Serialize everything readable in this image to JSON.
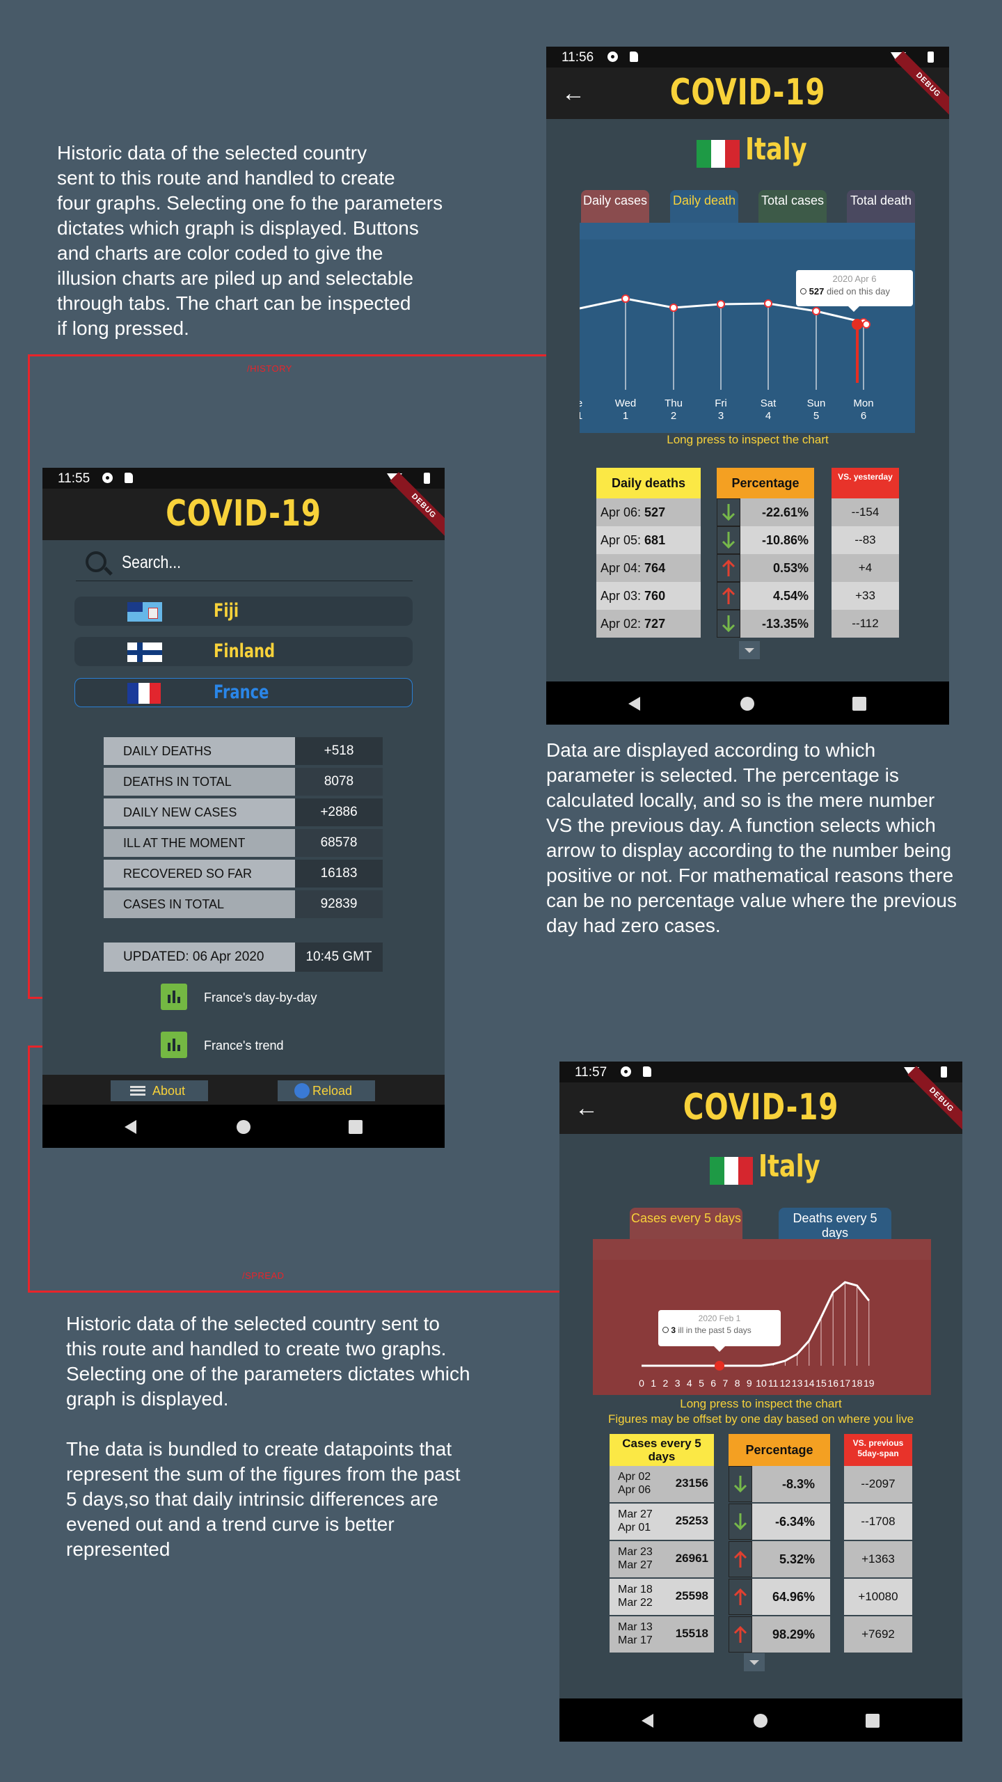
{
  "descriptions": {
    "history_top": [
      "Historic data of the selected country",
      "sent to this route and handled to create",
      "four graphs. Selecting one fo the parameters",
      "dictates which graph is displayed. Buttons",
      "and charts are color coded to give the",
      "illusion charts are piled up and selectable",
      "through tabs. The chart can be inspected",
      "if long pressed."
    ],
    "data_middle": [
      "Data are displayed according to which",
      "parameter is selected. The percentage is",
      "calculated locally, and so is the mere number",
      "VS the previous day. A function selects which",
      "arrow to display according to the number being",
      "positive or not. For mathematical reasons there",
      "can be no percentage value where the previous",
      "day had zero cases."
    ],
    "spread_bottom": [
      "Historic data of the selected country sent to",
      "this route and handled to create two graphs.",
      "Selecting one of the parameters dictates which",
      "graph is displayed.",
      "",
      "The data is bundled to create datapoints that",
      "represent the sum of the figures from the past",
      "5 days,so that daily intrinsic differences are",
      "evened out and a trend curve is better",
      "represented"
    ]
  },
  "routes": {
    "history": "/HISTORY",
    "spread": "/SPREAD"
  },
  "colors": {
    "background": "#485a68",
    "title_yellow": "#f8d23a",
    "route_red": "#e8242a",
    "chart_blue": "#2b5a80",
    "chart_red": "#8a3a3a",
    "arrow_green": "#76b84a",
    "arrow_red": "#e04030"
  },
  "app_title": "COVID-19",
  "debug_label": "DEBUG",
  "history": {
    "time": "11:56",
    "country": "Italy",
    "tabs": [
      {
        "label": "Daily cases",
        "color": "#8a4c4e"
      },
      {
        "label": "Daily death",
        "color": "#2d5b82"
      },
      {
        "label": "Total cases",
        "color": "#3d5a48"
      },
      {
        "label": "Total death",
        "color": "#4a4960"
      }
    ],
    "tooltip": {
      "date": "2020 Apr 6",
      "value": "527",
      "text": "died on this day"
    },
    "x_ticks": [
      [
        "e",
        "1"
      ],
      [
        "Wed",
        "1"
      ],
      [
        "Thu",
        "2"
      ],
      [
        "Fri",
        "3"
      ],
      [
        "Sat",
        "4"
      ],
      [
        "Sun",
        "5"
      ],
      [
        "Mon",
        "6"
      ]
    ],
    "hint": "Long press to inspect the chart",
    "table_headers": {
      "col1": "Daily deaths",
      "col2": "Percentage",
      "col3": "VS. yesterday"
    },
    "rows": [
      {
        "date": "Apr 06:",
        "value": "527",
        "trend": "down",
        "pct": "-22.61%",
        "vs": "--154"
      },
      {
        "date": "Apr 05:",
        "value": "681",
        "trend": "down",
        "pct": "-10.86%",
        "vs": "--83"
      },
      {
        "date": "Apr 04:",
        "value": "764",
        "trend": "up",
        "pct": "0.53%",
        "vs": "+4"
      },
      {
        "date": "Apr 03:",
        "value": "760",
        "trend": "up",
        "pct": "4.54%",
        "vs": "+33"
      },
      {
        "date": "Apr 02:",
        "value": "727",
        "trend": "down",
        "pct": "-13.35%",
        "vs": "--112"
      }
    ]
  },
  "chart_history": {
    "type": "line",
    "x": [
      "e 1",
      "Wed 1",
      "Thu 2",
      "Fri 3",
      "Sat 4",
      "Sun 5",
      "Mon 6"
    ],
    "note": "daily deaths Italy, selected point 2020 Apr 6 = 527"
  },
  "search_screen": {
    "time": "11:55",
    "search_placeholder": "Search...",
    "countries": [
      {
        "name": "Fiji",
        "selected": false
      },
      {
        "name": "Finland",
        "selected": false
      },
      {
        "name": "France",
        "selected": true
      }
    ],
    "stats": [
      {
        "label": "DAILY DEATHS",
        "value": "+518"
      },
      {
        "label": "DEATHS IN TOTAL",
        "value": "8078"
      },
      {
        "label": "DAILY NEW CASES",
        "value": "+2886"
      },
      {
        "label": "ILL AT THE MOMENT",
        "value": "68578"
      },
      {
        "label": "RECOVERED SO FAR",
        "value": "16183"
      },
      {
        "label": "CASES IN TOTAL",
        "value": "92839"
      }
    ],
    "updated_label": "UPDATED: 06 Apr 2020",
    "updated_time": "10:45 GMT",
    "links": [
      "France's day-by-day",
      "France's trend"
    ],
    "about": "About",
    "reload": "Reload"
  },
  "spread": {
    "time": "11:57",
    "country": "Italy",
    "tabs": [
      {
        "label": "Cases every 5 days",
        "color": "#8a4444",
        "text": "#f8d23a"
      },
      {
        "label": "Deaths every 5 days",
        "color": "#2d5b82",
        "text": "#ffffff"
      }
    ],
    "tooltip": {
      "date": "2020 Feb 1",
      "value": "3",
      "text": "ill in the past 5 days"
    },
    "x_ticks": [
      "0",
      "1",
      "2",
      "3",
      "4",
      "5",
      "6",
      "7",
      "8",
      "9",
      "10",
      "11",
      "12",
      "13",
      "14",
      "15",
      "16",
      "17",
      "18",
      "19"
    ],
    "hint1": "Long press to inspect the chart",
    "hint2": "Figures may be offset by one day based on where you live",
    "table_headers": {
      "col1": "Cases every 5 days",
      "col2": "Percentage",
      "col3": "VS. previous 5day-span"
    },
    "rows": [
      {
        "d1": "Apr 02",
        "d2": "Apr 06",
        "value": "23156",
        "trend": "down",
        "pct": "-8.3%",
        "vs": "--2097"
      },
      {
        "d1": "Mar 27",
        "d2": "Apr 01",
        "value": "25253",
        "trend": "down",
        "pct": "-6.34%",
        "vs": "--1708"
      },
      {
        "d1": "Mar 23",
        "d2": "Mar 27",
        "value": "26961",
        "trend": "up",
        "pct": "5.32%",
        "vs": "+1363"
      },
      {
        "d1": "Mar 18",
        "d2": "Mar 22",
        "value": "25598",
        "trend": "up",
        "pct": "64.96%",
        "vs": "+10080"
      },
      {
        "d1": "Mar 13",
        "d2": "Mar 17",
        "value": "15518",
        "trend": "up",
        "pct": "98.29%",
        "vs": "+7692"
      }
    ]
  }
}
